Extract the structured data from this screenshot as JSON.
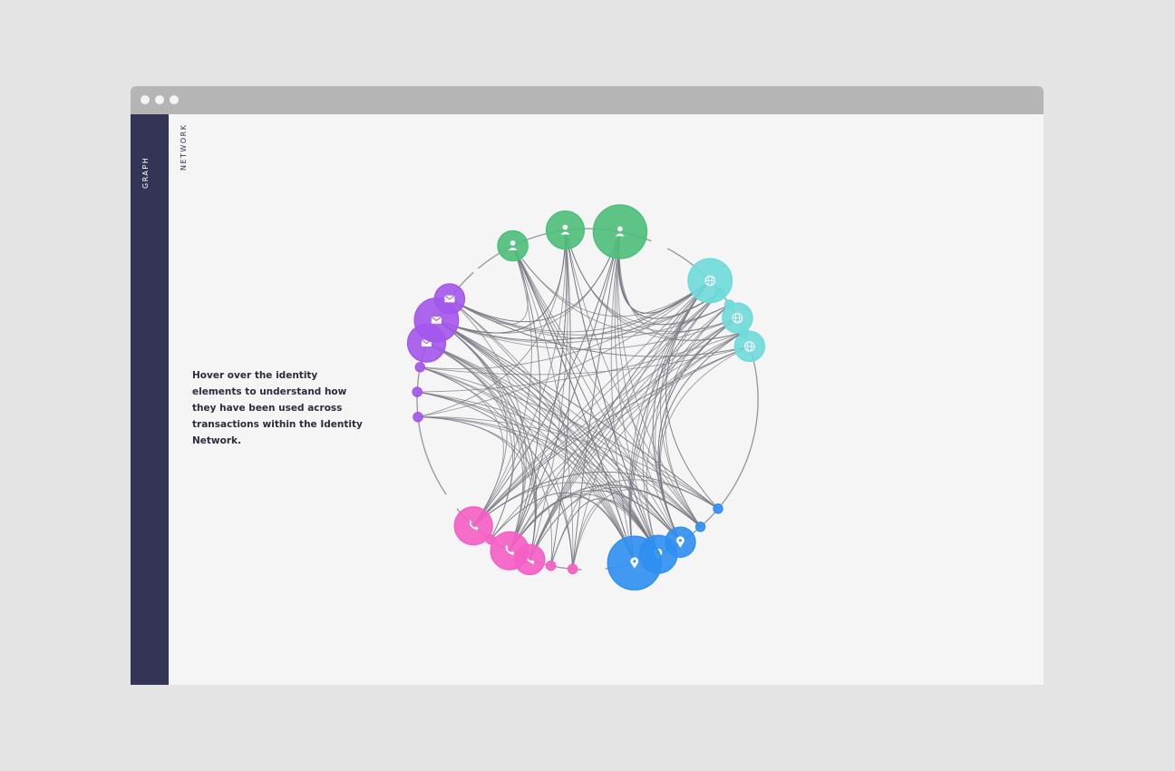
{
  "window": {
    "controls": [
      "window-dot",
      "window-dot",
      "window-dot"
    ]
  },
  "sidebar": {
    "tab_label": "GRAPH"
  },
  "section": {
    "tab_label": "NETWORK"
  },
  "description": "Hover over the identity elements to understand how they have been used across transactions within the Identity Network.",
  "colors": {
    "person": "#4cbf7a",
    "web": "#6fdada",
    "location": "#2f8ff2",
    "phone": "#f55ec4",
    "email": "#a456ec",
    "link": "#7a7a84",
    "sidebar": "#343457"
  },
  "network": {
    "groups": [
      {
        "type": "person",
        "icon": "person-icon",
        "color": "#4cbf7a",
        "nodes": [
          {
            "weight": 1,
            "icon": true
          },
          {
            "weight": 2,
            "icon": true
          },
          {
            "weight": 5,
            "icon": true
          }
        ]
      },
      {
        "type": "web",
        "icon": "globe-icon",
        "color": "#6fdada",
        "nodes": [
          {
            "weight": 3,
            "icon": true
          },
          {
            "weight": 0.3,
            "icon": false
          },
          {
            "weight": 0.3,
            "icon": false
          },
          {
            "weight": 1,
            "icon": true
          },
          {
            "weight": 0.3,
            "icon": false
          },
          {
            "weight": 1,
            "icon": true
          }
        ]
      },
      {
        "type": "location",
        "icon": "pin-icon",
        "color": "#2f8ff2",
        "nodes": [
          {
            "weight": 0.3,
            "icon": false
          },
          {
            "weight": 0.3,
            "icon": false
          },
          {
            "weight": 1,
            "icon": true
          },
          {
            "weight": 2,
            "icon": true
          },
          {
            "weight": 5,
            "icon": true
          }
        ]
      },
      {
        "type": "phone",
        "icon": "phone-icon",
        "color": "#f55ec4",
        "nodes": [
          {
            "weight": 0.3,
            "icon": false
          },
          {
            "weight": 0.3,
            "icon": false
          },
          {
            "weight": 1,
            "icon": true
          },
          {
            "weight": 2,
            "icon": true
          },
          {
            "weight": 0.3,
            "icon": false
          },
          {
            "weight": 2,
            "icon": true
          }
        ]
      },
      {
        "type": "email",
        "icon": "envelope-icon",
        "color": "#a456ec",
        "nodes": [
          {
            "weight": 0.3,
            "icon": false
          },
          {
            "weight": 0.3,
            "icon": false
          },
          {
            "weight": 0.3,
            "icon": false
          },
          {
            "weight": 2,
            "icon": true
          },
          {
            "weight": 3,
            "icon": true
          },
          {
            "weight": 1,
            "icon": true
          }
        ]
      }
    ]
  }
}
